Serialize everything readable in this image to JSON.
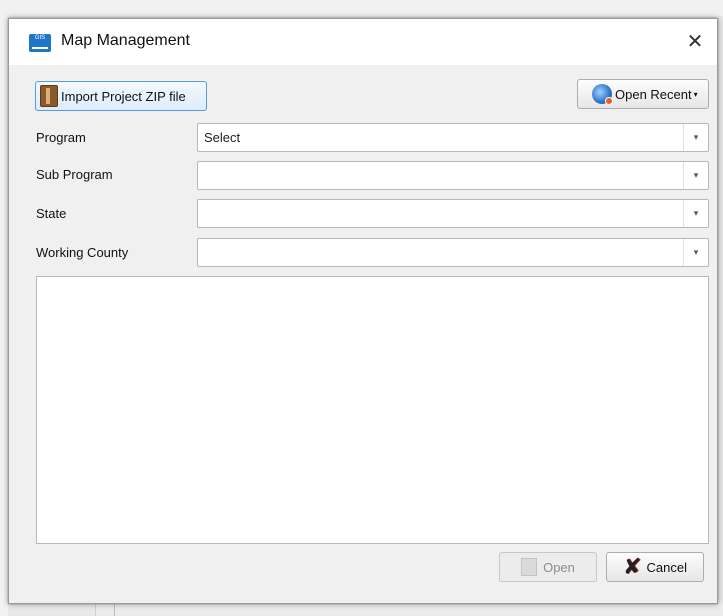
{
  "window": {
    "app_icon": "map-app-icon",
    "app_icon_text": "GIS",
    "title": "Map Management",
    "close_label": "✕"
  },
  "toolbar": {
    "import_label": "Import Project ZIP file",
    "import_icon": "zip-archive-icon",
    "open_recent_label": "Open Recent",
    "open_recent_icon": "globe-history-icon",
    "open_recent_caret": "▾"
  },
  "form": {
    "program": {
      "label": "Program",
      "value": "Select"
    },
    "sub_program": {
      "label": "Sub Program",
      "value": ""
    },
    "state": {
      "label": "State",
      "value": ""
    },
    "working_county": {
      "label": "Working County",
      "value": ""
    },
    "dropdown_arrow": "▾"
  },
  "footer": {
    "open_label": "Open",
    "open_enabled": false,
    "cancel_label": "Cancel",
    "cancel_icon": "cancel-x-icon"
  }
}
